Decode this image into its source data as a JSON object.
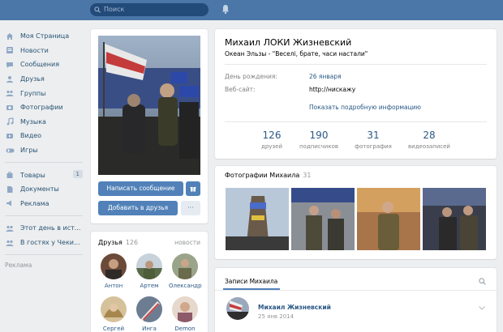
{
  "topbar": {
    "search_placeholder": "Поиск",
    "icons": [
      "search-icon",
      "bell-icon"
    ]
  },
  "left_menu": {
    "items": [
      {
        "label": "Моя Страница",
        "icon": "home-icon"
      },
      {
        "label": "Новости",
        "icon": "news-icon"
      },
      {
        "label": "Сообщения",
        "icon": "messages-icon"
      },
      {
        "label": "Друзья",
        "icon": "friends-icon"
      },
      {
        "label": "Группы",
        "icon": "groups-icon"
      },
      {
        "label": "Фотографии",
        "icon": "photos-icon"
      },
      {
        "label": "Музыка",
        "icon": "music-icon"
      },
      {
        "label": "Видео",
        "icon": "video-icon"
      },
      {
        "label": "Игры",
        "icon": "games-icon"
      }
    ],
    "items2": [
      {
        "label": "Товары",
        "icon": "goods-icon",
        "badge": "1"
      },
      {
        "label": "Документы",
        "icon": "documents-icon"
      },
      {
        "label": "Реклама",
        "icon": "ads-icon"
      }
    ],
    "items3": [
      {
        "label": "Этот день в ист...",
        "icon": "people-icon"
      },
      {
        "label": "В гостях у Чеки...",
        "icon": "people-icon"
      }
    ],
    "footer": "Реклама"
  },
  "profile_photo": {
    "send_message_label": "Написать сообщение",
    "add_friend_label": "Добавить в друзья",
    "more_label": "···"
  },
  "friends": {
    "title": "Друзья",
    "count": "126",
    "link": "новости",
    "items": [
      {
        "name": "Антон"
      },
      {
        "name": "Артем"
      },
      {
        "name": "Олександр"
      },
      {
        "name": "Сергей"
      },
      {
        "name": "Инга"
      },
      {
        "name": "Demon"
      }
    ]
  },
  "profile": {
    "name": "Михаил ЛОКИ Жизневский",
    "status": "Океан Эльзы - \"Веселі, брате, часи настали\"",
    "birthday_label": "День рождения:",
    "birthday_value": "26 января",
    "website_label": "Веб-сайт:",
    "website_value": "http://нискажу",
    "show_more": "Показать подробную информацию",
    "stats": [
      {
        "num": "126",
        "label": "друзей"
      },
      {
        "num": "190",
        "label": "подписчиков"
      },
      {
        "num": "31",
        "label": "фотография"
      },
      {
        "num": "28",
        "label": "видеозаписей"
      }
    ]
  },
  "photos": {
    "title": "Фотографии Михаила",
    "count": "31"
  },
  "wall": {
    "tab": "Записи Михаила",
    "post_author": "Михаил Жизневский",
    "post_date": "25 янв 2014"
  },
  "colors": {
    "topbar": "#4a76a8",
    "accent": "#5181b8",
    "link": "#2a5885",
    "background": "#edeef0"
  }
}
